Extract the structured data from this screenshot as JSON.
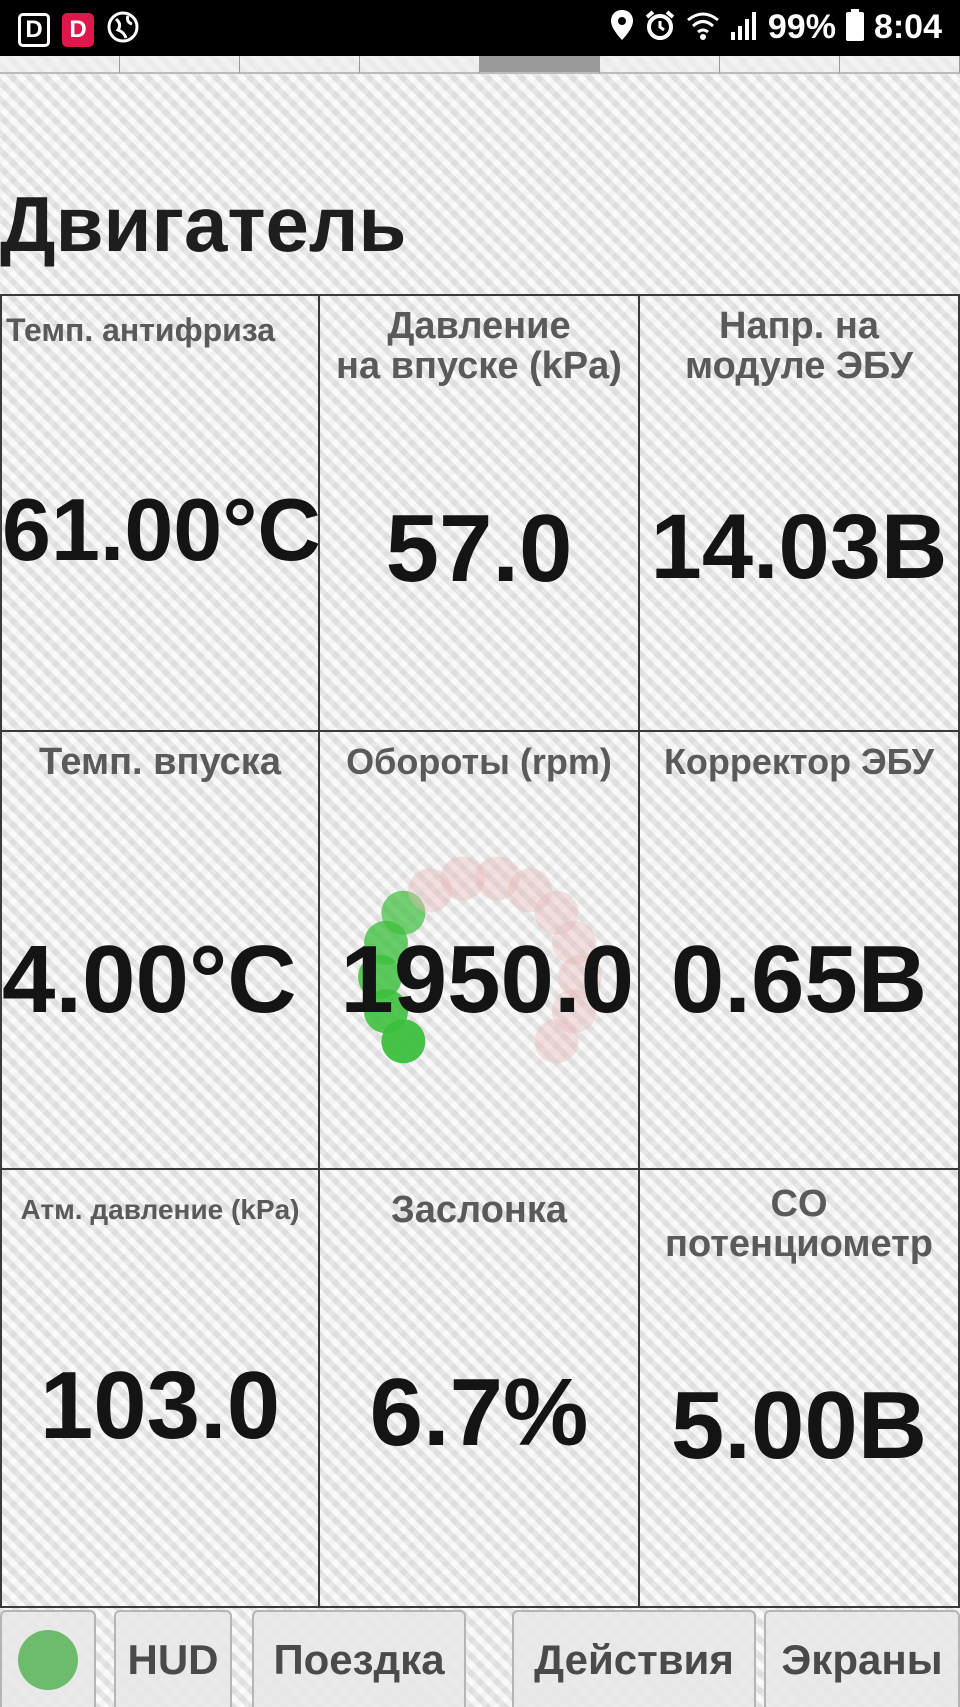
{
  "status_bar": {
    "left_icons": [
      "D",
      "D",
      "globe-icon"
    ],
    "battery": "99%",
    "time": "8:04"
  },
  "page_tabs": {
    "count": 8,
    "active_index": 4
  },
  "title": "Двигатель",
  "cells": [
    {
      "label": "Темп. антифриза",
      "value": "61.00°C"
    },
    {
      "label": "Давление\nна впуске (kPa)",
      "value": "57.0"
    },
    {
      "label": "Напр. на\nмодуле ЭБУ",
      "value": "14.03B"
    },
    {
      "label": "Темп. впуска",
      "value": "4.00°C"
    },
    {
      "label": "Обороты (rpm)",
      "value": "1950.0"
    },
    {
      "label": "Корректор ЭБУ",
      "value": "0.65B"
    },
    {
      "label": "Атм. давление (kPa)",
      "value": "103.0"
    },
    {
      "label": "Заслонка",
      "value": "6.7%"
    },
    {
      "label": "CO\nпотенциометр",
      "value": "5.00B"
    }
  ],
  "rpm_gauge": {
    "fraction": 0.36,
    "active_color": "#3cbf3c",
    "inactive_color": "#e8b8b8"
  },
  "bottom_tabs": [
    {
      "label": "",
      "indicator_color": "#6dbb6d"
    },
    {
      "label": "HUD"
    },
    {
      "label": "Поездка"
    },
    {
      "label": "Действия"
    },
    {
      "label": "Экраны"
    }
  ]
}
